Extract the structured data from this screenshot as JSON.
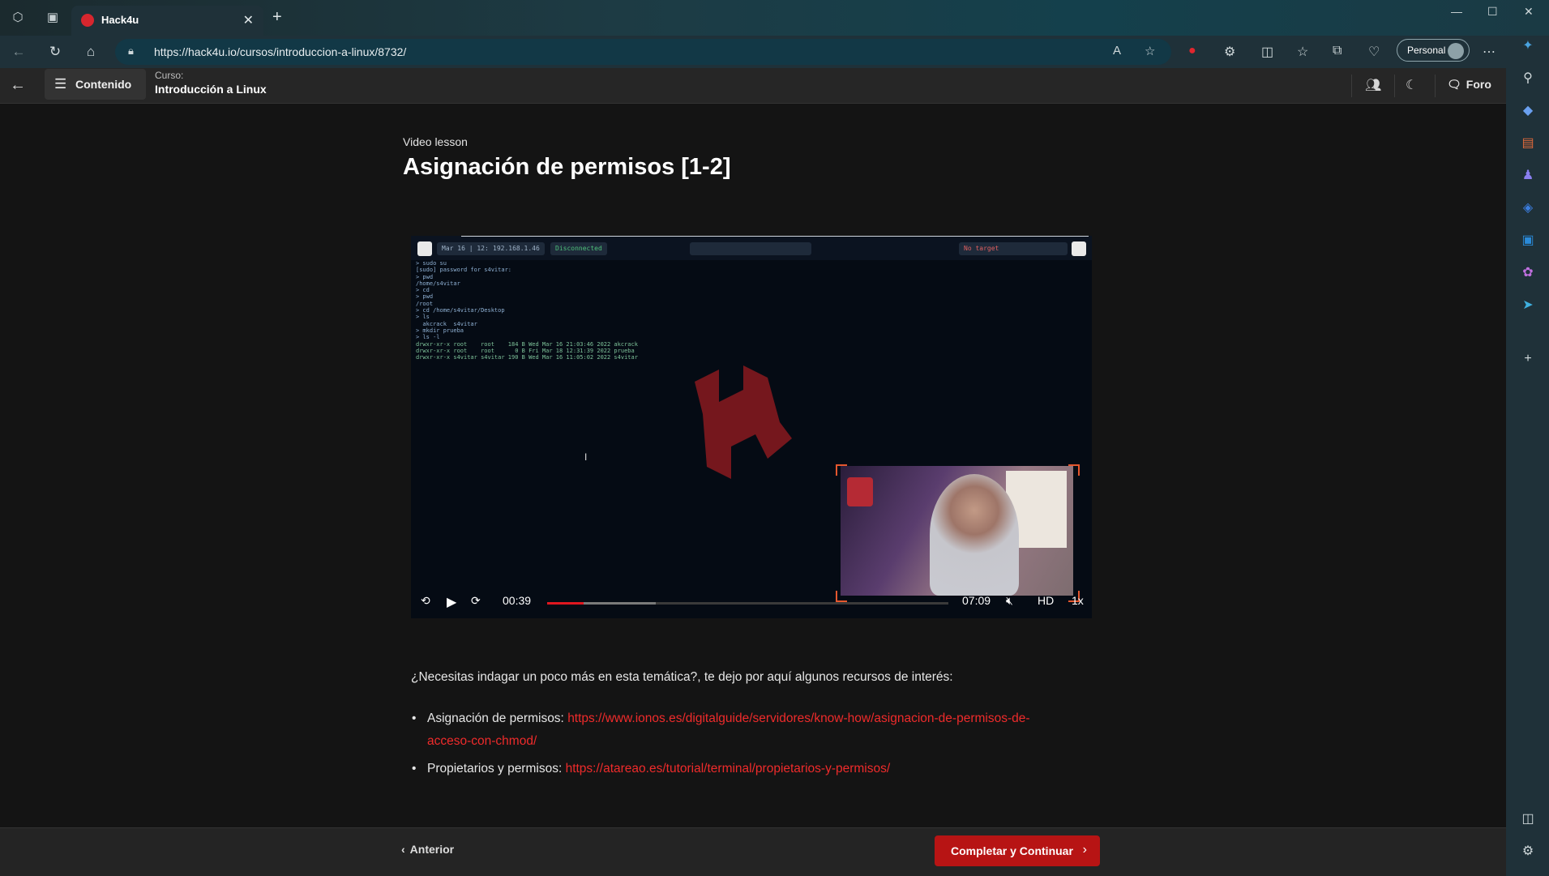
{
  "browser": {
    "tab_title": "Hack4u",
    "url": "https://hack4u.io/cursos/introduccion-a-linux/8732/",
    "profile_label": "Personal"
  },
  "header": {
    "menu_label": "Contenido",
    "course_key": "Curso:",
    "course_name": "Introducción a Linux",
    "forum_label": "Foro"
  },
  "lesson": {
    "kind": "Video lesson",
    "title": "Asignación de permisos [1-2]"
  },
  "video": {
    "current_time": "00:39",
    "duration": "07:09",
    "quality": "HD",
    "speed": "1x",
    "progress": 0.09,
    "buffered": 0.27,
    "terminal_topbar": [
      "Mar 16 | 12:31",
      "192.168.1.46",
      "Disconnected",
      "No target"
    ],
    "terminal_lines": [
      "> sudo su",
      "[sudo] password for s4vitar:",
      "> pwd",
      "/home/s4vitar",
      "> cd",
      "> pwd",
      "/root",
      "> cd /home/s4vitar/Desktop",
      "> ls",
      "  akcrack  s4vitar",
      "> mkdir prueba",
      "> ls -l",
      "drwxr-xr-x root    root    184 B Wed Mar 16 21:03:46 2022 akcrack",
      "drwxr-xr-x root    root      0 B Fri Mar 18 12:31:39 2022 prueba",
      "drwxr-xr-x s4vitar s4vitar 190 B Wed Mar 16 11:05:02 2022 s4vitar"
    ]
  },
  "resources": {
    "intro": "¿Necesitas indagar un poco más en esta temática?, te dejo por aquí algunos recursos de interés:",
    "items": [
      {
        "label": "Asignación de permisos:",
        "link_line1": "https://www.ionos.es/digitalguide/servidores/know-how/asignacion-de-permisos-de-",
        "link_line2": "acceso-con-chmod/"
      },
      {
        "label": "Propietarios y permisos:",
        "link": "https://atareao.es/tutorial/terminal/propietarios-y-permisos/"
      }
    ]
  },
  "footer": {
    "prev_label": "Anterior",
    "next_label": "Completar y Continuar"
  },
  "colors": {
    "accent": "#b71414",
    "link": "#ef2b2b",
    "background": "#141414"
  }
}
